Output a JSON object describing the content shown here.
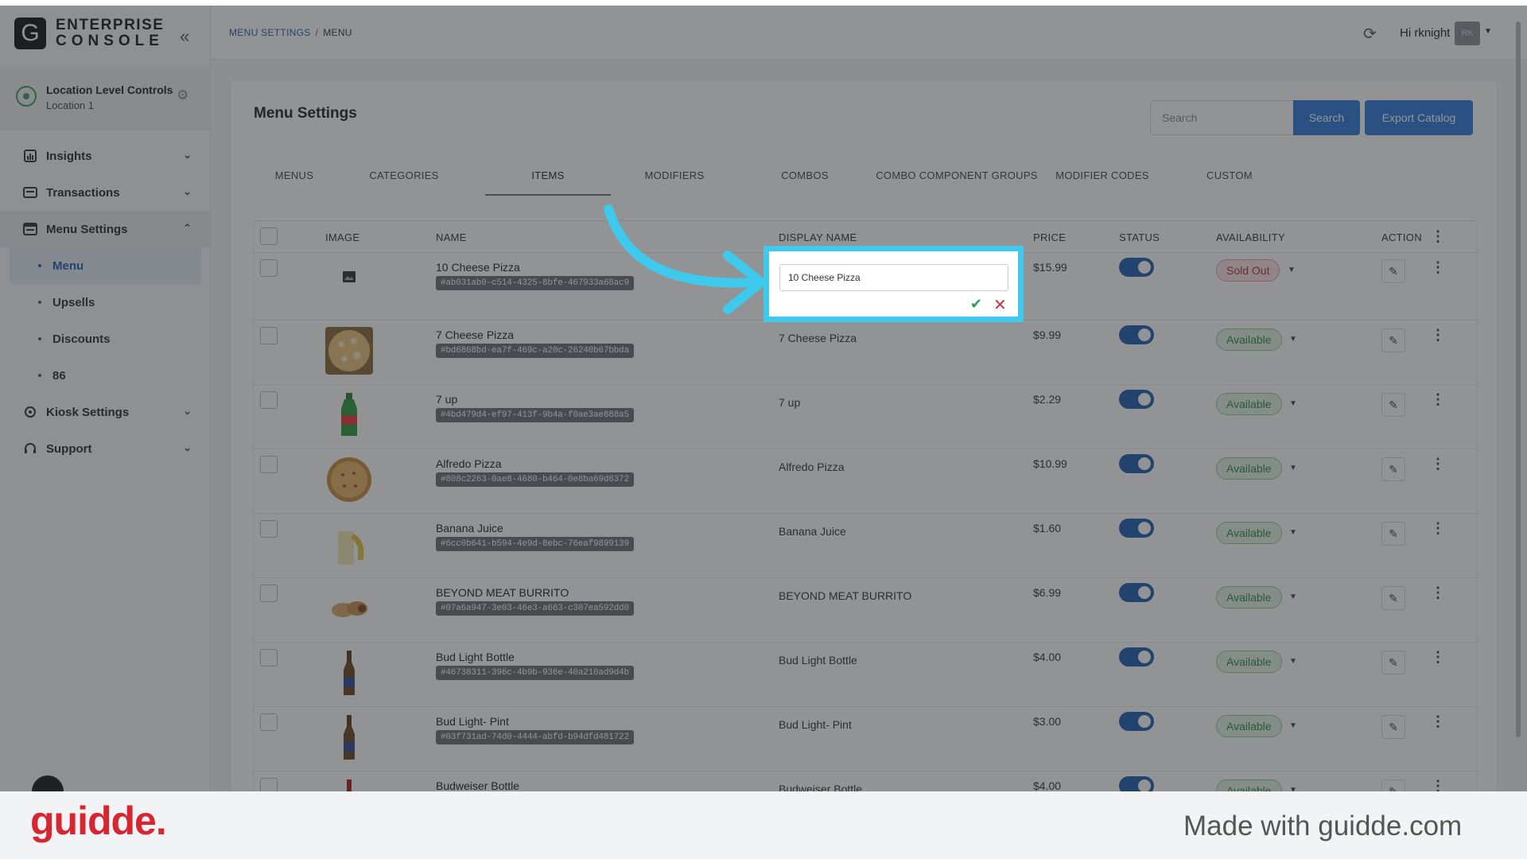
{
  "brand": {
    "logo_letter": "G",
    "line1": "ENTERPRISE",
    "line2": "CONSOLE"
  },
  "location": {
    "title": "Location Level Controls",
    "subtitle": "Location 1"
  },
  "sidebar": {
    "items": [
      {
        "label": "Insights"
      },
      {
        "label": "Transactions"
      },
      {
        "label": "Menu Settings"
      },
      {
        "label": "Kiosk Settings"
      },
      {
        "label": "Support"
      }
    ],
    "subitems": [
      {
        "label": "Menu"
      },
      {
        "label": "Upsells"
      },
      {
        "label": "Discounts"
      },
      {
        "label": "86"
      }
    ]
  },
  "header": {
    "breadcrumb_link": "MENU SETTINGS",
    "breadcrumb_sep": "/",
    "breadcrumb_current": "MENU",
    "greeting": "Hi rknight",
    "avatar_initials": "RK"
  },
  "page": {
    "title": "Menu Settings",
    "search_placeholder": "Search",
    "search_button": "Search",
    "export_button": "Export Catalog"
  },
  "tabs": [
    "MENUS",
    "CATEGORIES",
    "ITEMS",
    "MODIFIERS",
    "COMBOS",
    "COMBO COMPONENT GROUPS",
    "MODIFIER CODES",
    "CUSTOM"
  ],
  "active_tab": "ITEMS",
  "table": {
    "headers": [
      "IMAGE",
      "NAME",
      "DISPLAY NAME",
      "PRICE",
      "STATUS",
      "AVAILABILITY",
      "ACTION"
    ],
    "rows": [
      {
        "name": "10 Cheese Pizza",
        "id": "#ab031ab0-c514-4325-8bfe-467933a68ac9",
        "display": "",
        "price": "$15.99",
        "availability": "Sold Out"
      },
      {
        "name": "7 Cheese Pizza",
        "id": "#bd6868bd-ea7f-469c-a20c-26240b67bbda",
        "display": "7 Cheese Pizza",
        "price": "$9.99",
        "availability": "Available"
      },
      {
        "name": "7 up",
        "id": "#4bd479d4-ef97-413f-9b4a-f0ae3ae888a5",
        "display": "7 up",
        "price": "$2.29",
        "availability": "Available"
      },
      {
        "name": "Alfredo Pizza",
        "id": "#808c2263-0ae8-4680-b464-0e8ba69d6372",
        "display": "Alfredo Pizza",
        "price": "$10.99",
        "availability": "Available"
      },
      {
        "name": "Banana Juice",
        "id": "#6cc0b641-b594-4e9d-8ebc-76eaf9899139",
        "display": "Banana Juice",
        "price": "$1.60",
        "availability": "Available"
      },
      {
        "name": "BEYOND MEAT BURRITO",
        "id": "#07a6a947-3e03-46e3-a663-c307ea592dd0",
        "display": "BEYOND MEAT BURRITO",
        "price": "$6.99",
        "availability": "Available"
      },
      {
        "name": "Bud Light Bottle",
        "id": "#46738311-396c-4b9b-936e-40a210ad9d4b",
        "display": "Bud Light Bottle",
        "price": "$4.00",
        "availability": "Available"
      },
      {
        "name": "Bud Light- Pint",
        "id": "#03f731ad-74d0-4444-abfd-b94dfd481722",
        "display": "Bud Light- Pint",
        "price": "$3.00",
        "availability": "Available"
      },
      {
        "name": "Budweiser Bottle",
        "id": "",
        "display": "Budweiser Bottle",
        "price": "$4.00",
        "availability": "Available"
      }
    ]
  },
  "editor": {
    "value": "10 Cheese Pizza"
  },
  "footer": {
    "logo": "guidde.",
    "made_with": "Made with guidde.com"
  },
  "colors": {
    "primary": "#2f7ad7",
    "highlight": "#3fc9ec",
    "sold_out": "#b9313d",
    "available": "#2f8a45",
    "footer_logo": "#d72631"
  }
}
